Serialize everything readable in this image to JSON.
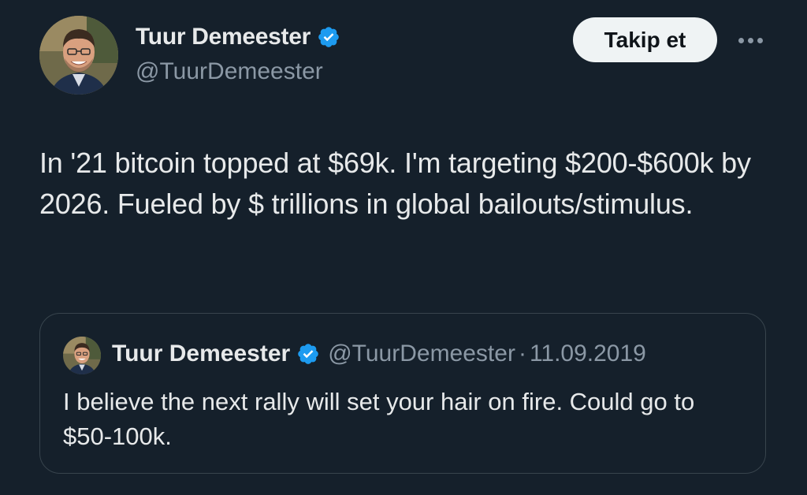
{
  "tweet": {
    "author": {
      "name": "Tuur Demeester",
      "handle": "@TuurDemeester",
      "verified": true
    },
    "follow_label": "Takip et",
    "text": "In '21 bitcoin topped at $69k. I'm targeting $200-$600k by 2026. Fueled by $ trillions in global bailouts/stimulus."
  },
  "quote": {
    "author": {
      "name": "Tuur Demeester",
      "handle": "@TuurDemeester",
      "verified": true
    },
    "separator": "·",
    "date": "11.09.2019",
    "text": "I believe the next rally will set your hair on fire. Could go to $50-100k."
  },
  "icons": {
    "verified": "verified-badge-icon",
    "more": "more-options-icon"
  },
  "colors": {
    "background": "#15202b",
    "text_primary": "#e7e9ea",
    "text_secondary": "#8b98a5",
    "verified_blue": "#1d9bf0",
    "follow_button_bg": "#eff3f4",
    "border": "#38444d"
  }
}
